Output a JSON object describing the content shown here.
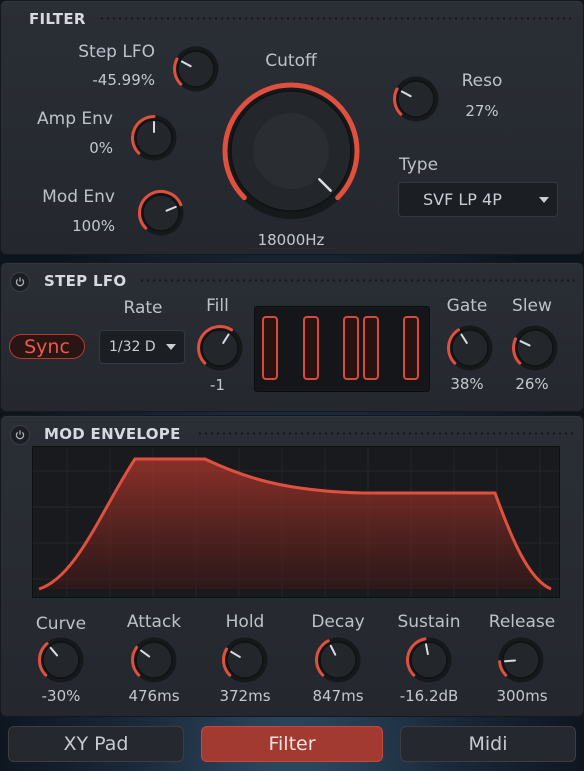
{
  "filter": {
    "title": "FILTER",
    "step_lfo": {
      "label": "Step LFO",
      "value": "-45.99%"
    },
    "amp_env": {
      "label": "Amp Env",
      "value": "0%"
    },
    "mod_env": {
      "label": "Mod Env",
      "value": "100%"
    },
    "cutoff": {
      "label": "Cutoff",
      "value": "18000Hz"
    },
    "reso": {
      "label": "Reso",
      "value": "27%"
    },
    "type": {
      "label": "Type",
      "selected": "SVF LP 4P"
    }
  },
  "step_lfo": {
    "title": "STEP LFO",
    "sync_label": "Sync",
    "rate": {
      "label": "Rate",
      "selected": "1/32 D"
    },
    "fill": {
      "label": "Fill",
      "value": "-1"
    },
    "gate": {
      "label": "Gate",
      "value": "38%"
    },
    "slew": {
      "label": "Slew",
      "value": "26%"
    }
  },
  "mod_envelope": {
    "title": "MOD ENVELOPE",
    "curve": {
      "label": "Curve",
      "value": "-30%"
    },
    "attack": {
      "label": "Attack",
      "value": "476ms"
    },
    "hold": {
      "label": "Hold",
      "value": "372ms"
    },
    "decay": {
      "label": "Decay",
      "value": "847ms"
    },
    "sustain": {
      "label": "Sustain",
      "value": "-16.2dB"
    },
    "release": {
      "label": "Release",
      "value": "300ms"
    }
  },
  "tabs": [
    {
      "label": "XY Pad",
      "active": false
    },
    {
      "label": "Filter",
      "active": true
    },
    {
      "label": "Midi",
      "active": false
    }
  ],
  "colors": {
    "accent": "#e0503e",
    "panel": "#272b31",
    "text": "#c9ced6"
  },
  "icons": {
    "power": "power-icon",
    "dropdown": "chevron-down-icon"
  }
}
